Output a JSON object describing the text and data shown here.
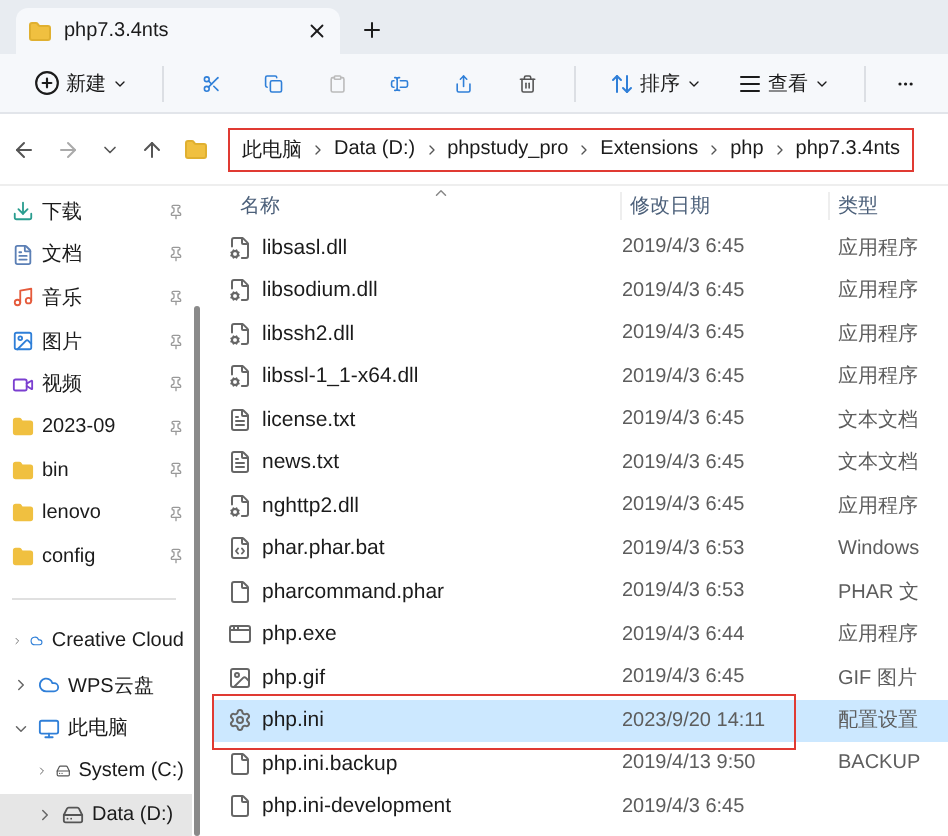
{
  "tab": {
    "title": "php7.3.4nts",
    "selected": true
  },
  "toolbar": {
    "new": "新建",
    "sort": "排序",
    "view": "查看"
  },
  "breadcrumb": {
    "highlighted": true,
    "parts": [
      "此电脑",
      "Data (D:)",
      "phpstudy_pro",
      "Extensions",
      "php",
      "php7.3.4nts"
    ]
  },
  "sidebar": {
    "pinned": [
      {
        "label": "下载"
      },
      {
        "label": "文档"
      },
      {
        "label": "音乐"
      },
      {
        "label": "图片"
      },
      {
        "label": "视频"
      },
      {
        "label": "2023-09"
      },
      {
        "label": "bin"
      },
      {
        "label": "lenovo"
      },
      {
        "label": "config"
      }
    ],
    "tree": [
      {
        "label": "Creative Cloud",
        "expanded": false,
        "selected": false
      },
      {
        "label": "WPS云盘",
        "expanded": false,
        "selected": false
      },
      {
        "label": "此电脑",
        "expanded": true,
        "selected": false,
        "children": [
          {
            "label": "System (C:)",
            "expanded": false,
            "selected": false
          },
          {
            "label": "Data (D:)",
            "expanded": false,
            "selected": true
          }
        ]
      }
    ]
  },
  "columns": [
    "名称",
    "修改日期",
    "类型"
  ],
  "files": [
    {
      "name": "libsasl.dll",
      "date": "2019/4/3 6:45",
      "type": "应用程序",
      "kind": "extension",
      "selected": false,
      "highlighted": false
    },
    {
      "name": "libsodium.dll",
      "date": "2019/4/3 6:45",
      "type": "应用程序",
      "kind": "extension",
      "selected": false,
      "highlighted": false
    },
    {
      "name": "libssh2.dll",
      "date": "2019/4/3 6:45",
      "type": "应用程序",
      "kind": "extension",
      "selected": false,
      "highlighted": false
    },
    {
      "name": "libssl-1_1-x64.dll",
      "date": "2019/4/3 6:45",
      "type": "应用程序",
      "kind": "extension",
      "selected": false,
      "highlighted": false
    },
    {
      "name": "license.txt",
      "date": "2019/4/3 6:45",
      "type": "文本文档",
      "kind": "text",
      "selected": false,
      "highlighted": false
    },
    {
      "name": "news.txt",
      "date": "2019/4/3 6:45",
      "type": "文本文档",
      "kind": "text",
      "selected": false,
      "highlighted": false
    },
    {
      "name": "nghttp2.dll",
      "date": "2019/4/3 6:45",
      "type": "应用程序",
      "kind": "extension",
      "selected": false,
      "highlighted": false
    },
    {
      "name": "phar.phar.bat",
      "date": "2019/4/3 6:53",
      "type": "Windows",
      "kind": "script",
      "selected": false,
      "highlighted": false
    },
    {
      "name": "pharcommand.phar",
      "date": "2019/4/3 6:53",
      "type": "PHAR 文",
      "kind": "file",
      "selected": false,
      "highlighted": false
    },
    {
      "name": "php.exe",
      "date": "2019/4/3 6:44",
      "type": "应用程序",
      "kind": "app",
      "selected": false,
      "highlighted": false
    },
    {
      "name": "php.gif",
      "date": "2019/4/3 6:45",
      "type": "GIF 图片",
      "kind": "image",
      "selected": false,
      "highlighted": false
    },
    {
      "name": "php.ini",
      "date": "2023/9/20 14:11",
      "type": "配置设置",
      "kind": "settings",
      "selected": true,
      "highlighted": true
    },
    {
      "name": "php.ini.backup",
      "date": "2019/4/13 9:50",
      "type": "BACKUP",
      "kind": "file",
      "selected": false,
      "highlighted": false
    },
    {
      "name": "php.ini-development",
      "date": "2019/4/3 6:45",
      "kind": "file",
      "selected": false,
      "highlighted": false
    }
  ]
}
